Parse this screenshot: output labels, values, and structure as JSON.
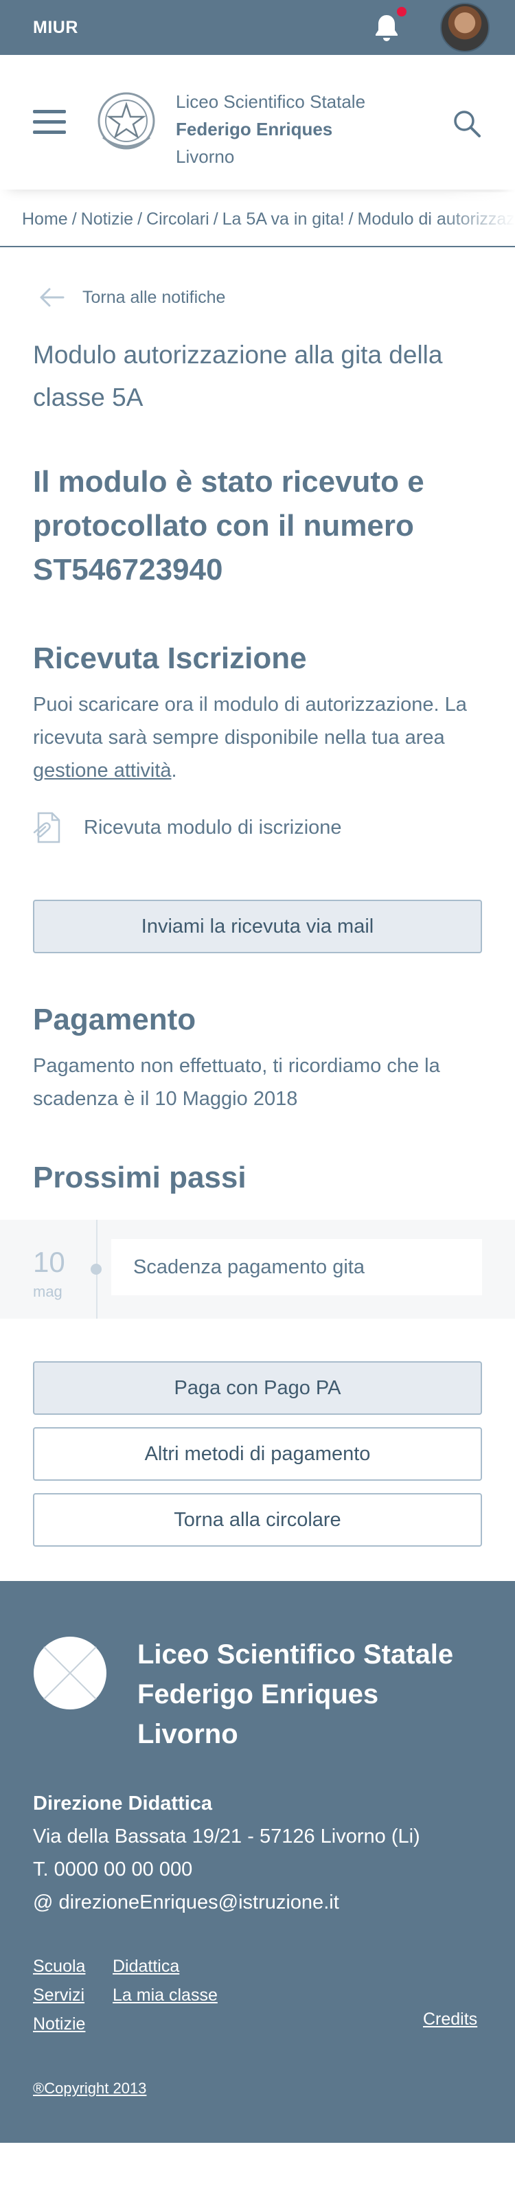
{
  "topbar": {
    "brand": "MIUR"
  },
  "header": {
    "school_line1": "Liceo Scientifico Statale",
    "school_line2": "Federigo Enriques",
    "school_line3": "Livorno"
  },
  "breadcrumb": [
    "Home",
    "Notizie",
    "Circolari",
    "La 5A va in gita!",
    "Modulo di autorizzazione"
  ],
  "back": {
    "label": "Torna alle notifiche"
  },
  "page_title": "Modulo autorizzazione alla gita della classe 5A",
  "received": "Il modulo è stato ricevuto e protocollato con il numero ST546723940",
  "receipt": {
    "title": "Ricevuta Iscrizione",
    "text_before": "Puoi scaricare ora il modulo di autorizzazione. La ricevuta sarà sempre disponibile nella tua area ",
    "link": "gestione attività",
    "text_after": ".",
    "file_label": "Ricevuta modulo di iscrizione",
    "mail_button": "Inviami la ricevuta via mail"
  },
  "payment": {
    "title": "Pagamento",
    "text": "Pagamento non effettuato, ti ricordiamo che la scadenza è il 10 Maggio 2018"
  },
  "next_steps": {
    "title": "Prossimi passi",
    "day": "10",
    "month": "mag",
    "event": "Scadenza pagamento gita"
  },
  "actions": {
    "pay_pagopa": "Paga con Pago PA",
    "other_methods": "Altri metodi di pagamento",
    "back_circular": "Torna alla circolare"
  },
  "footer": {
    "name_line1": "Liceo Scientifico Statale",
    "name_line2": "Federigo Enriques",
    "name_line3": "Livorno",
    "direction": "Direzione Didattica",
    "address": "Via della Bassata 19/21 - 57126 Livorno (Li)",
    "phone": "T. 0000 00 00 000",
    "email": "@ direzioneEnriques@istruzione.it",
    "links": {
      "scuola": "Scuola",
      "didattica": "Didattica",
      "servizi": "Servizi",
      "la_mia_classe": "La mia classe",
      "notizie": "Notizie"
    },
    "credits": "Credits",
    "copyright": "®Copyright 2013"
  },
  "colors": {
    "primary": "#5c778c",
    "button_fill": "#e6ebf1",
    "notification_dot": "#e5173f"
  },
  "icons": {
    "bell": "bell-icon",
    "menu": "hamburger-menu-icon",
    "search": "search-icon",
    "back": "arrow-left-icon",
    "file": "document-attachment-icon",
    "emblem": "italian-republic-emblem",
    "footer_logo": "placeholder-logo"
  }
}
